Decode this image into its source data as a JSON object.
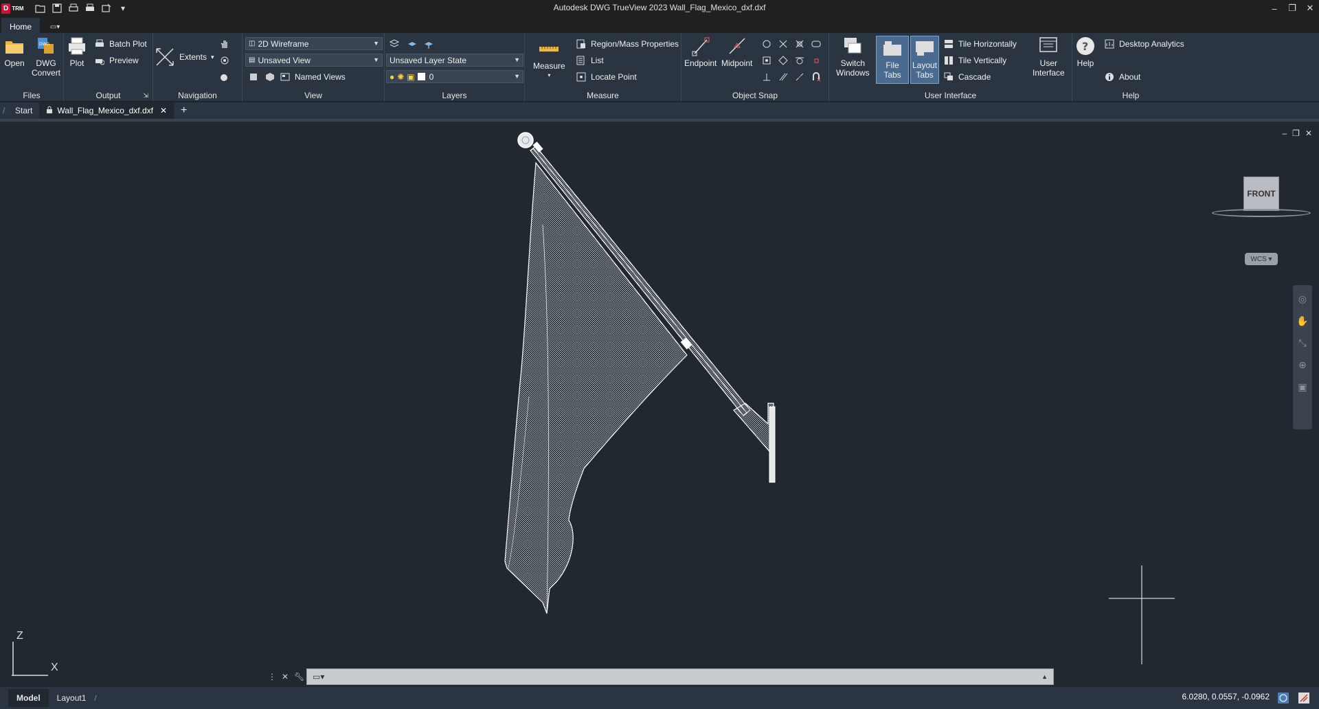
{
  "titlebar": {
    "app_logo": "D",
    "app_logo_sub": "TRM",
    "title": "Autodesk DWG TrueView 2023    Wall_Flag_Mexico_dxf.dxf",
    "qat_icons": [
      "open-icon",
      "save-icon",
      "print-icon",
      "plot-icon",
      "publish-icon",
      "qat-menu-icon"
    ]
  },
  "ribbon_tabs": {
    "home": "Home"
  },
  "ribbon": {
    "files": {
      "label": "Files",
      "open": "Open",
      "dwg_convert_1": "DWG",
      "dwg_convert_2": "Convert"
    },
    "output": {
      "label": "Output",
      "plot": "Plot",
      "batch_plot": "Batch Plot",
      "preview": "Preview"
    },
    "navigation": {
      "label": "Navigation",
      "extents": "Extents"
    },
    "view": {
      "label": "View",
      "visual_style": "2D Wireframe",
      "saved_view": "Unsaved View",
      "named_views": "Named Views"
    },
    "layers": {
      "label": "Layers",
      "layer_state": "Unsaved Layer State",
      "current_layer": "0"
    },
    "measure": {
      "label": "Measure",
      "measure": "Measure",
      "region_mass": "Region/Mass Properties",
      "list": "List",
      "locate_point": "Locate Point"
    },
    "object_snap": {
      "label": "Object Snap",
      "endpoint": "Endpoint",
      "midpoint": "Midpoint"
    },
    "user_interface": {
      "label": "User Interface",
      "switch_windows_1": "Switch",
      "switch_windows_2": "Windows",
      "file_tabs": "File Tabs",
      "layout_tabs_1": "Layout",
      "layout_tabs_2": "Tabs",
      "tile_h": "Tile Horizontally",
      "tile_v": "Tile Vertically",
      "cascade": "Cascade",
      "ui_1": "User",
      "ui_2": "Interface"
    },
    "help": {
      "label": "Help",
      "help": "Help",
      "desktop_analytics": "Desktop Analytics",
      "about": "About"
    }
  },
  "doc_tabs": {
    "start": "Start",
    "file": "Wall_Flag_Mexico_dxf.dxf"
  },
  "viewport": {
    "viewcube_face": "FRONT",
    "wcs": "WCS",
    "ucs_z": "Z",
    "ucs_x": "X"
  },
  "status": {
    "model": "Model",
    "layout1": "Layout1",
    "coords": "6.0280, 0.0557, -0.0962"
  }
}
